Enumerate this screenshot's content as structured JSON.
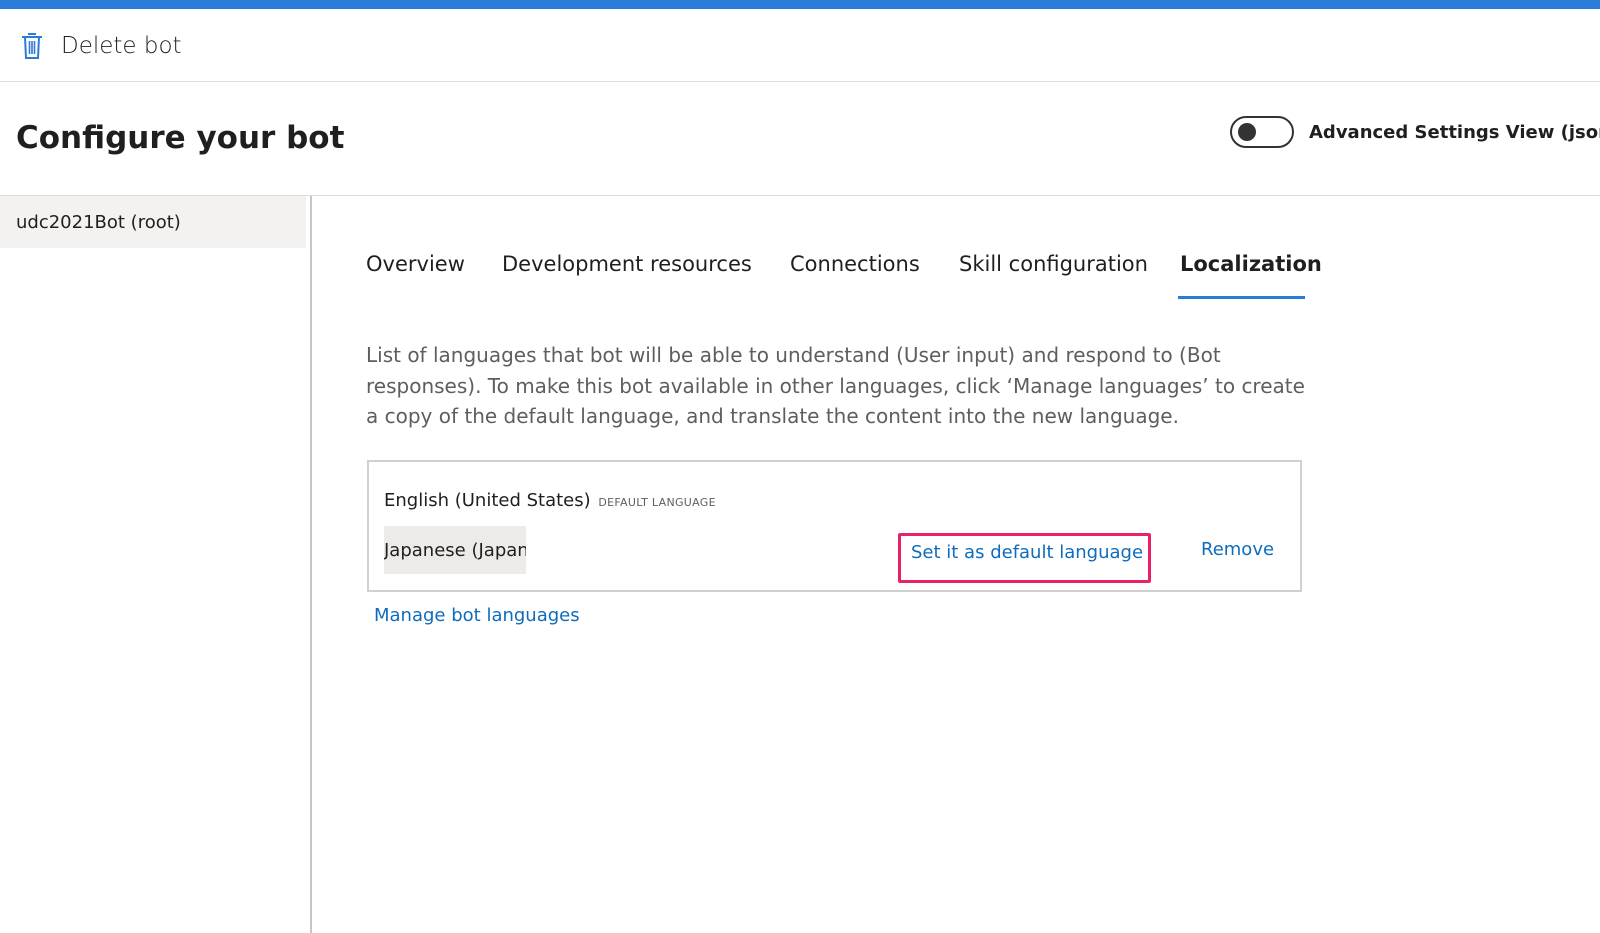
{
  "toolbar": {
    "delete_label": "Delete bot",
    "delete_icon": "trash-icon"
  },
  "page": {
    "title": "Configure your bot"
  },
  "advanced_toggle": {
    "label": "Advanced Settings View (json",
    "state": "off"
  },
  "sidebar": {
    "items": [
      {
        "label": "udc2021Bot (root)",
        "selected": true
      }
    ]
  },
  "tabs": [
    {
      "label": "Overview",
      "active": false
    },
    {
      "label": "Development resources",
      "active": false
    },
    {
      "label": "Connections",
      "active": false
    },
    {
      "label": "Skill configuration",
      "active": false
    },
    {
      "label": "Localization",
      "active": true
    }
  ],
  "localization": {
    "description": "List of languages that bot will be able to understand (User input) and respond to (Bot responses). To make this bot available in other languages, click ‘Manage languages’ to create a copy of the default language, and translate the content into the new language.",
    "languages": [
      {
        "name": "English (United States)",
        "badge": "DEFAULT LANGUAGE"
      },
      {
        "name": "Japanese (Japan)",
        "set_default_label": "Set it as default language",
        "remove_label": "Remove"
      }
    ],
    "manage_label": "Manage bot languages"
  },
  "colors": {
    "accent": "#2b7bd8",
    "link": "#0f6cbd",
    "highlight": "#e8226a"
  }
}
